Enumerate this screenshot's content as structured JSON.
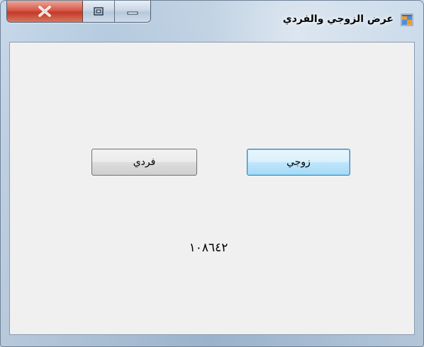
{
  "window": {
    "title": "عرض الزوجي والفردي",
    "icon": "windows-forms-app-icon"
  },
  "caption_buttons": {
    "close_icon": "close-icon",
    "maximize_icon": "maximize-icon",
    "minimize_icon": "minimize-icon"
  },
  "buttons": {
    "even_label": "زوجي",
    "odd_label": "فردي"
  },
  "result": {
    "text": "١٠٨٦٤٢"
  },
  "colors": {
    "close_button": "#c9453a",
    "client_background": "#f0f0f0",
    "focused_button_border": "#3c7fb1"
  }
}
